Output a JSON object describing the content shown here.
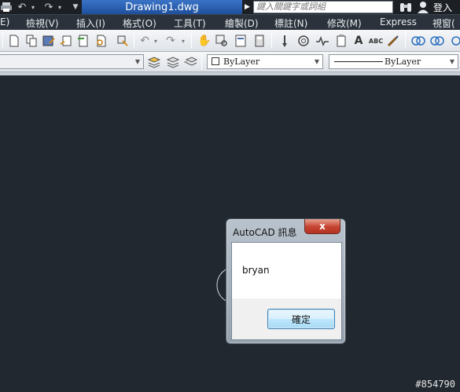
{
  "titlebar": {
    "document_title": "Drawing1.dwg",
    "search_placeholder": "鍵入關鍵字或詞組",
    "login_label": "登入"
  },
  "menu": {
    "items": [
      "E)",
      "檢視(V)",
      "插入(I)",
      "格式(O)",
      "工具(T)",
      "繪製(D)",
      "標註(N)",
      "修改(M)",
      "Express",
      "視窗("
    ]
  },
  "properties": {
    "color_value": "ByLayer",
    "linetype_value": "ByLayer"
  },
  "dialog": {
    "title": "AutoCAD 訊息",
    "close_label": "x",
    "message": "bryan",
    "ok_label": "確定"
  },
  "watermark": "#854790"
}
